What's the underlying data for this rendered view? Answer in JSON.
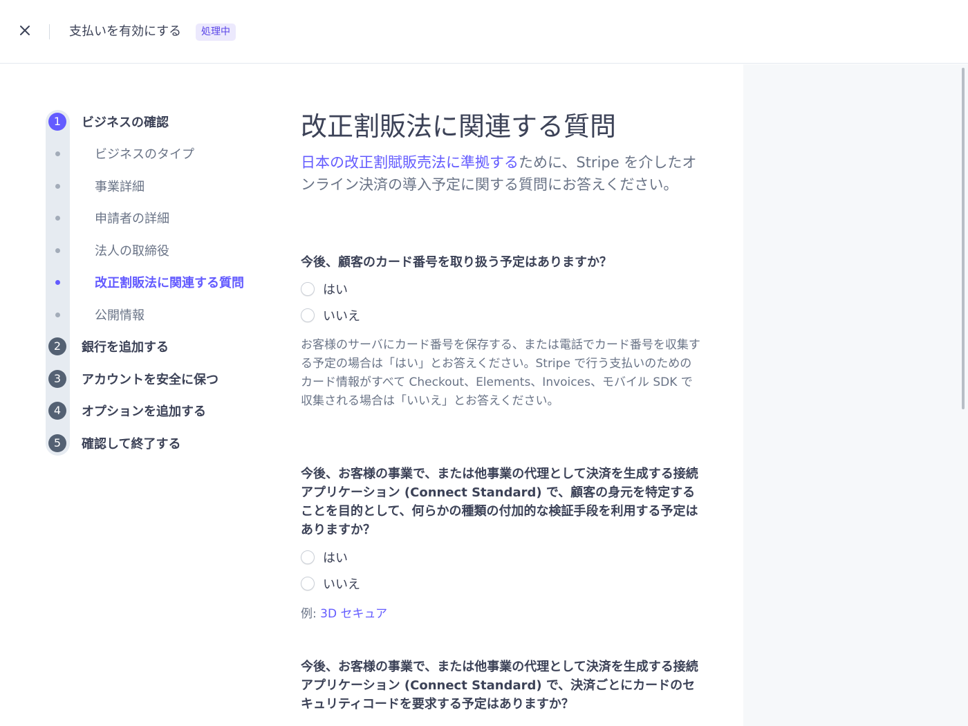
{
  "header": {
    "title": "支払いを有効にする",
    "badge": "処理中"
  },
  "stepper": {
    "steps": [
      {
        "number": "1",
        "label": "ビジネスの確認"
      },
      {
        "number": "2",
        "label": "銀行を追加する"
      },
      {
        "number": "3",
        "label": "アカウントを安全に保つ"
      },
      {
        "number": "4",
        "label": "オプションを追加する"
      },
      {
        "number": "5",
        "label": "確認して終了する"
      }
    ],
    "substeps": [
      {
        "label": "ビジネスのタイプ"
      },
      {
        "label": "事業詳細"
      },
      {
        "label": "申請者の詳細"
      },
      {
        "label": "法人の取締役"
      },
      {
        "label": "改正割販法に関連する質問"
      },
      {
        "label": "公開情報"
      }
    ]
  },
  "main": {
    "title": "改正割販法に関連する質問",
    "intro_link": "日本の改正割賦販売法に準拠する",
    "intro_rest": "ために、Stripe を介したオンライン決済の導入予定に関する質問にお答えください。",
    "questions": [
      {
        "text": "今後、顧客のカード番号を取り扱う予定はありますか？",
        "options": [
          "はい",
          "いいえ"
        ],
        "help": "お客様のサーバにカード番号を保存する、または電話でカード番号を収集する予定の場合は「はい」とお答えください。Stripe で行う支払いのためのカード情報がすべて Checkout、Elements、Invoices、モバイル SDK で収集される場合は「いいえ」とお答えください。"
      },
      {
        "text": "今後、お客様の事業で、または他事業の代理として決済を生成する接続アプリケーション (Connect Standard) で、顧客の身元を特定することを目的として、何らかの種類の付加的な検証手段を利用する予定はありますか？",
        "options": [
          "はい",
          "いいえ"
        ],
        "help_prefix": "例: ",
        "help_link": "3D セキュア"
      },
      {
        "text": "今後、お客様の事業で、または他事業の代理として決済を生成する接続アプリケーション (Connect Standard) で、決済ごとにカードのセキュリティコードを要求する予定はありますか？"
      }
    ]
  },
  "colors": {
    "accent": "#635bff",
    "text": "#3c4257",
    "muted": "#697386",
    "panel": "#f6f8fa"
  }
}
